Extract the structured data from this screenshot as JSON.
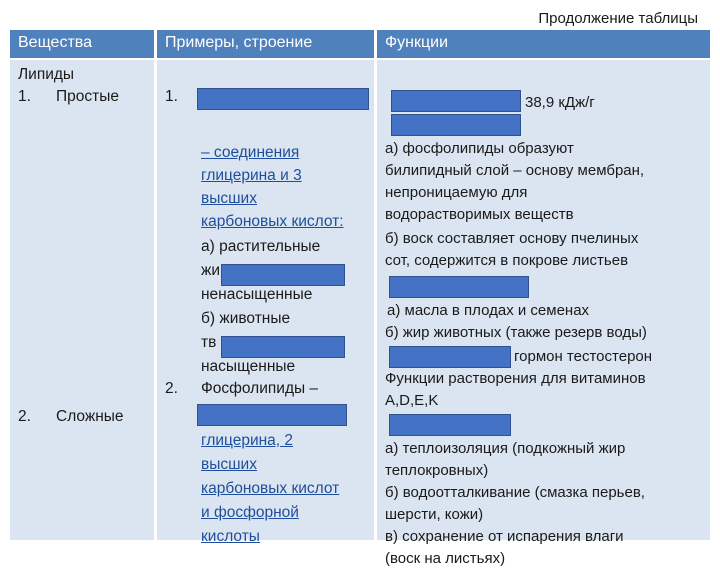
{
  "top_note": "Продолжение таблицы",
  "headers": {
    "col1": "Вещества",
    "col2": "Примеры, строение",
    "col3": "Функции"
  },
  "col1": {
    "title": "Липиды",
    "item1_num": "1.",
    "item1_label": "Простые",
    "item2_num": "2.",
    "item2_label": "Сложные"
  },
  "col2": {
    "num1": "1.",
    "l1": "– соединения",
    "l2": "глицерина и 3",
    "l3": "высших",
    "l4": "карбоновых кислот:",
    "l5": "а) растительные",
    "l6": "жи",
    "l7": "ненасыщенные",
    "l8": "б) животные",
    "l9": "тв",
    "l10": "насыщенные",
    "num2": "2.",
    "l11": "Фосфолипиды –",
    "l12": "глицерина, 2",
    "l13": "высших",
    "l14": "карбоновых кислот",
    "l15": "и фосфорной",
    "l16": "кислоты"
  },
  "col3": {
    "energy": "38,9 кДж/г",
    "f1": "а) фосфолипиды образуют",
    "f2": "билипидный слой – основу мембран,",
    "f3": "непроницаемую для",
    "f4": "водорастворимых веществ",
    "f5": "б) воск составляет основу пчелиных",
    "f6": "сот, содержится в покрове листьев",
    "f7": "а) масла в плодах и семенах",
    "f8": "б) жир животных (также резерв воды)",
    "f9": "гормон тестостерон",
    "f10": "Функции растворения для витаминов",
    "f11": "A,D,E,K",
    "f12": "а) теплоизоляция (подкожный жир",
    "f13": "теплокровных)",
    "f14": "б) водоотталкивание (смазка перьев,",
    "f15": "шерсти, кожи)",
    "f16": "в) сохранение от испарения влаги",
    "f17": "(воск на листьях)"
  },
  "colors": {
    "header_bg": "#4f81bd",
    "cell_bg": "#dbe5f1",
    "mask": "#4472c4",
    "link": "#1f4e9c"
  }
}
